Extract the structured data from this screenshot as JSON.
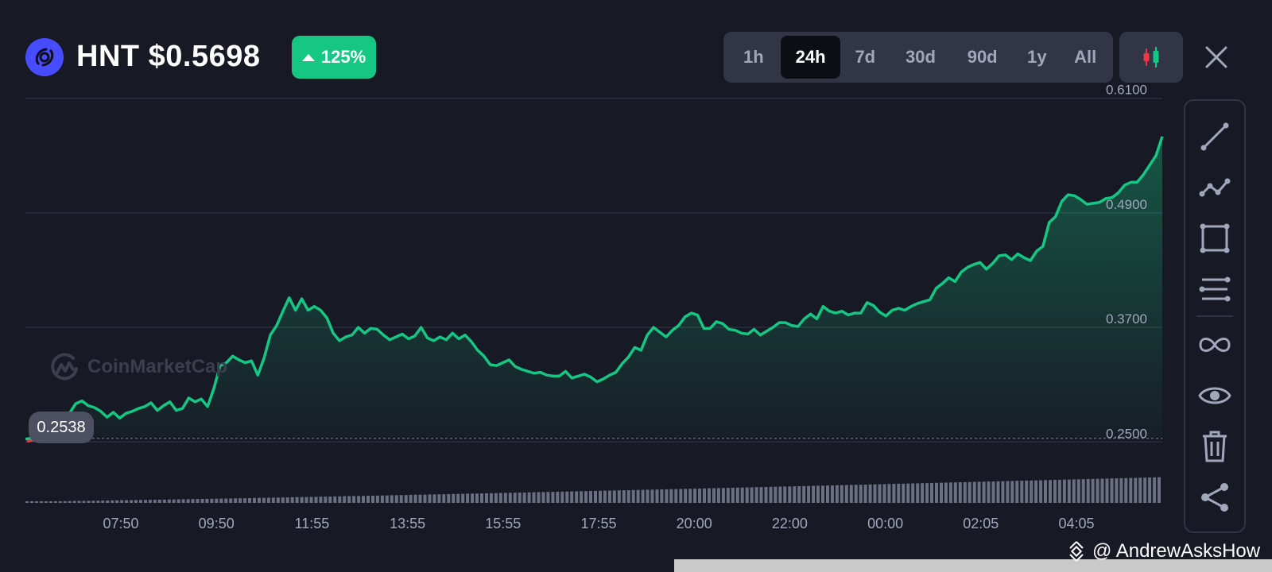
{
  "header": {
    "symbol_price": "HNT $0.5698",
    "change": "125%",
    "logo_icon": "helium-logo-icon"
  },
  "ranges": [
    "1h",
    "24h",
    "7d",
    "30d",
    "90d",
    "1y",
    "All"
  ],
  "active_range": "24h",
  "icons": {
    "candlestick": "candlestick-icon",
    "close": "close-icon",
    "tools": [
      "trend-line-icon",
      "polyline-icon",
      "rectangle-icon",
      "horizontal-lines-icon",
      "infinity-icon",
      "eye-icon",
      "trash-icon",
      "share-icon"
    ]
  },
  "watermark": "CoinMarketCap",
  "current_label": "0.2538",
  "credit": "@ AndrewAsksHow",
  "colors": {
    "up": "#16c784",
    "down": "#ea3943",
    "accent": "#474dff",
    "background": "#171924"
  },
  "chart_data": {
    "type": "area",
    "title": "",
    "xlabel": "",
    "ylabel": "",
    "y_ticks": [
      "0.6100",
      "0.4900",
      "0.3700",
      "0.2500"
    ],
    "ylim": [
      0.2386,
      0.6214
    ],
    "x_tick_labels": [
      "07:50",
      "09:50",
      "11:55",
      "13:55",
      "15:55",
      "17:55",
      "20:00",
      "22:00",
      "00:00",
      "02:05",
      "04:05"
    ],
    "baseline": 0.2538,
    "grid": true,
    "series": [
      {
        "values": [
          0.253,
          0.254,
          0.255,
          0.262,
          0.27,
          0.27,
          0.272,
          0.28,
          0.29,
          0.293,
          0.288,
          0.286,
          0.282,
          0.276,
          0.281,
          0.275,
          0.28,
          0.282,
          0.285,
          0.287,
          0.291,
          0.283,
          0.288,
          0.292,
          0.283,
          0.285,
          0.296,
          0.292,
          0.295,
          0.287,
          0.306,
          0.33,
          0.333,
          0.34,
          0.336,
          0.333,
          0.335,
          0.32,
          0.338,
          0.362,
          0.372,
          0.387,
          0.401,
          0.388,
          0.4,
          0.388,
          0.392,
          0.388,
          0.38,
          0.364,
          0.356,
          0.36,
          0.362,
          0.37,
          0.364,
          0.369,
          0.368,
          0.362,
          0.357,
          0.36,
          0.363,
          0.358,
          0.361,
          0.37,
          0.359,
          0.356,
          0.36,
          0.357,
          0.364,
          0.358,
          0.362,
          0.355,
          0.346,
          0.34,
          0.331,
          0.33,
          0.333,
          0.336,
          0.329,
          0.326,
          0.324,
          0.322,
          0.323,
          0.32,
          0.319,
          0.319,
          0.324,
          0.317,
          0.319,
          0.321,
          0.318,
          0.313,
          0.316,
          0.32,
          0.323,
          0.332,
          0.339,
          0.349,
          0.346,
          0.362,
          0.37,
          0.365,
          0.36,
          0.367,
          0.372,
          0.381,
          0.385,
          0.383,
          0.369,
          0.369,
          0.376,
          0.374,
          0.368,
          0.367,
          0.364,
          0.363,
          0.368,
          0.362,
          0.366,
          0.37,
          0.375,
          0.375,
          0.372,
          0.371,
          0.379,
          0.384,
          0.379,
          0.392,
          0.387,
          0.385,
          0.387,
          0.383,
          0.385,
          0.385,
          0.396,
          0.393,
          0.386,
          0.382,
          0.388,
          0.39,
          0.388,
          0.392,
          0.395,
          0.397,
          0.399,
          0.411,
          0.416,
          0.422,
          0.418,
          0.428,
          0.433,
          0.436,
          0.438,
          0.431,
          0.437,
          0.445,
          0.446,
          0.441,
          0.447,
          0.443,
          0.44,
          0.45,
          0.455,
          0.48,
          0.486,
          0.502,
          0.509,
          0.508,
          0.504,
          0.499,
          0.5,
          0.501,
          0.505,
          0.506,
          0.511,
          0.519,
          0.522,
          0.522,
          0.53,
          0.54,
          0.55,
          0.57
        ]
      }
    ],
    "volume": {
      "type": "bar",
      "values": [
        0.05,
        0.95
      ]
    }
  }
}
